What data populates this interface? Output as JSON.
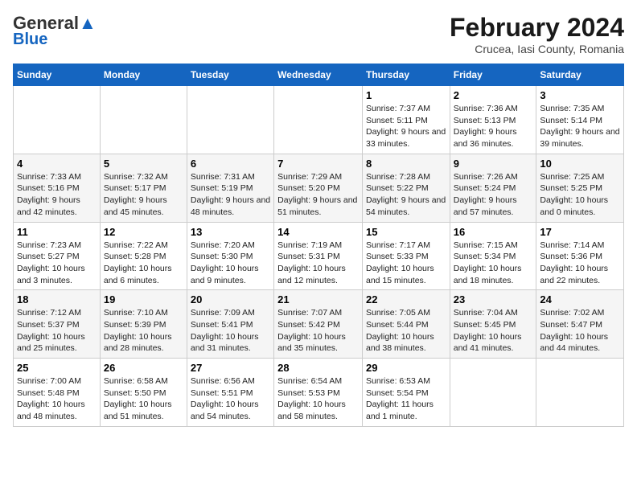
{
  "header": {
    "logo_line1": "General",
    "logo_line2": "Blue",
    "month": "February 2024",
    "location": "Crucea, Iasi County, Romania"
  },
  "days_of_week": [
    "Sunday",
    "Monday",
    "Tuesday",
    "Wednesday",
    "Thursday",
    "Friday",
    "Saturday"
  ],
  "weeks": [
    [
      {
        "day": "",
        "info": ""
      },
      {
        "day": "",
        "info": ""
      },
      {
        "day": "",
        "info": ""
      },
      {
        "day": "",
        "info": ""
      },
      {
        "day": "1",
        "info": "Sunrise: 7:37 AM\nSunset: 5:11 PM\nDaylight: 9 hours and 33 minutes."
      },
      {
        "day": "2",
        "info": "Sunrise: 7:36 AM\nSunset: 5:13 PM\nDaylight: 9 hours and 36 minutes."
      },
      {
        "day": "3",
        "info": "Sunrise: 7:35 AM\nSunset: 5:14 PM\nDaylight: 9 hours and 39 minutes."
      }
    ],
    [
      {
        "day": "4",
        "info": "Sunrise: 7:33 AM\nSunset: 5:16 PM\nDaylight: 9 hours and 42 minutes."
      },
      {
        "day": "5",
        "info": "Sunrise: 7:32 AM\nSunset: 5:17 PM\nDaylight: 9 hours and 45 minutes."
      },
      {
        "day": "6",
        "info": "Sunrise: 7:31 AM\nSunset: 5:19 PM\nDaylight: 9 hours and 48 minutes."
      },
      {
        "day": "7",
        "info": "Sunrise: 7:29 AM\nSunset: 5:20 PM\nDaylight: 9 hours and 51 minutes."
      },
      {
        "day": "8",
        "info": "Sunrise: 7:28 AM\nSunset: 5:22 PM\nDaylight: 9 hours and 54 minutes."
      },
      {
        "day": "9",
        "info": "Sunrise: 7:26 AM\nSunset: 5:24 PM\nDaylight: 9 hours and 57 minutes."
      },
      {
        "day": "10",
        "info": "Sunrise: 7:25 AM\nSunset: 5:25 PM\nDaylight: 10 hours and 0 minutes."
      }
    ],
    [
      {
        "day": "11",
        "info": "Sunrise: 7:23 AM\nSunset: 5:27 PM\nDaylight: 10 hours and 3 minutes."
      },
      {
        "day": "12",
        "info": "Sunrise: 7:22 AM\nSunset: 5:28 PM\nDaylight: 10 hours and 6 minutes."
      },
      {
        "day": "13",
        "info": "Sunrise: 7:20 AM\nSunset: 5:30 PM\nDaylight: 10 hours and 9 minutes."
      },
      {
        "day": "14",
        "info": "Sunrise: 7:19 AM\nSunset: 5:31 PM\nDaylight: 10 hours and 12 minutes."
      },
      {
        "day": "15",
        "info": "Sunrise: 7:17 AM\nSunset: 5:33 PM\nDaylight: 10 hours and 15 minutes."
      },
      {
        "day": "16",
        "info": "Sunrise: 7:15 AM\nSunset: 5:34 PM\nDaylight: 10 hours and 18 minutes."
      },
      {
        "day": "17",
        "info": "Sunrise: 7:14 AM\nSunset: 5:36 PM\nDaylight: 10 hours and 22 minutes."
      }
    ],
    [
      {
        "day": "18",
        "info": "Sunrise: 7:12 AM\nSunset: 5:37 PM\nDaylight: 10 hours and 25 minutes."
      },
      {
        "day": "19",
        "info": "Sunrise: 7:10 AM\nSunset: 5:39 PM\nDaylight: 10 hours and 28 minutes."
      },
      {
        "day": "20",
        "info": "Sunrise: 7:09 AM\nSunset: 5:41 PM\nDaylight: 10 hours and 31 minutes."
      },
      {
        "day": "21",
        "info": "Sunrise: 7:07 AM\nSunset: 5:42 PM\nDaylight: 10 hours and 35 minutes."
      },
      {
        "day": "22",
        "info": "Sunrise: 7:05 AM\nSunset: 5:44 PM\nDaylight: 10 hours and 38 minutes."
      },
      {
        "day": "23",
        "info": "Sunrise: 7:04 AM\nSunset: 5:45 PM\nDaylight: 10 hours and 41 minutes."
      },
      {
        "day": "24",
        "info": "Sunrise: 7:02 AM\nSunset: 5:47 PM\nDaylight: 10 hours and 44 minutes."
      }
    ],
    [
      {
        "day": "25",
        "info": "Sunrise: 7:00 AM\nSunset: 5:48 PM\nDaylight: 10 hours and 48 minutes."
      },
      {
        "day": "26",
        "info": "Sunrise: 6:58 AM\nSunset: 5:50 PM\nDaylight: 10 hours and 51 minutes."
      },
      {
        "day": "27",
        "info": "Sunrise: 6:56 AM\nSunset: 5:51 PM\nDaylight: 10 hours and 54 minutes."
      },
      {
        "day": "28",
        "info": "Sunrise: 6:54 AM\nSunset: 5:53 PM\nDaylight: 10 hours and 58 minutes."
      },
      {
        "day": "29",
        "info": "Sunrise: 6:53 AM\nSunset: 5:54 PM\nDaylight: 11 hours and 1 minute."
      },
      {
        "day": "",
        "info": ""
      },
      {
        "day": "",
        "info": ""
      }
    ]
  ]
}
